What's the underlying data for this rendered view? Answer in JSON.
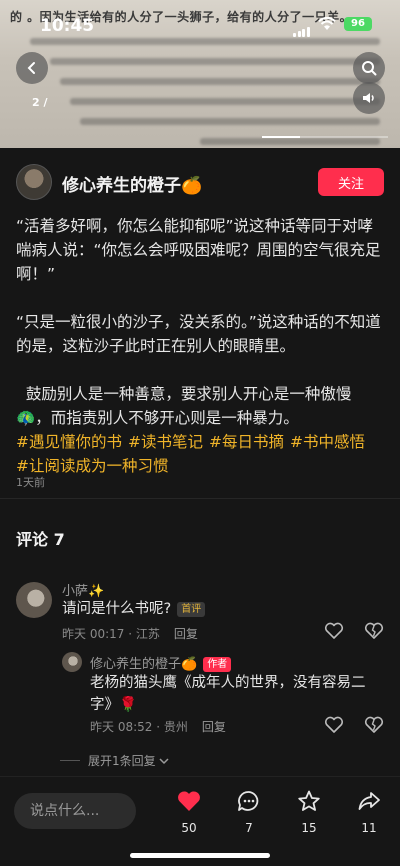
{
  "status_bar": {
    "time": "10:45",
    "battery": "96"
  },
  "photo": {
    "top_text": "的    。因为生活给有的人分了一头狮子，给有的人分了一只羊。",
    "page_indicator": "2 /",
    "progress_fraction": 0.3
  },
  "author": {
    "name": "修心养生的橙子🍊",
    "follow_label": "关注"
  },
  "post": {
    "paragraph1": "“活着多好啊，你怎么能抑郁呢”说这种话等同于对哮喘病人说：“你怎么会呼吸困难呢？周围的空气很充足啊！”",
    "paragraph2": "“只是一粒很小的沙子，没关系的。”说这种话的不知道的是，这粒沙子此时正在别人的眼睛里。",
    "paragraph3": "  鼓励别人是一种善意，要求别人开心是一种傲慢🦚，而指责别人不够开心则是一种暴力。",
    "tags": [
      "#遇见懂你的书",
      "#读书笔记",
      "#每日书摘",
      "#书中感悟",
      "#让阅读成为一种习惯"
    ],
    "time": "1天前"
  },
  "comments": {
    "title": "评论 7",
    "items": [
      {
        "name": "小萨✨",
        "text": "请问是什么书呢?",
        "badge": "首评",
        "time": "昨天 00:17 · 江苏",
        "reply": "回复"
      },
      {
        "name": "修心养生的橙子🍊",
        "text": "老杨的猫头鹰《成年人的世界，没有容易二字》🌹",
        "badge": "作者",
        "time": "昨天 08:52 · 贵州",
        "reply": "回复"
      }
    ],
    "expand": "展开1条回复"
  },
  "bottom_bar": {
    "placeholder": "说点什么...",
    "likes": "50",
    "comments": "7",
    "stars": "15",
    "shares": "11"
  },
  "colors": {
    "accent": "#ff2e4d",
    "tag": "#f0b429"
  }
}
